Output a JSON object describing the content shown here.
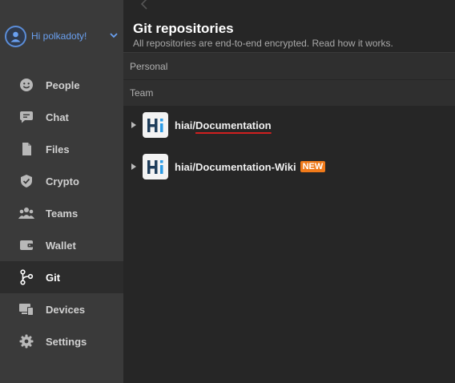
{
  "user": {
    "greeting": "Hi polkadoty!",
    "avatar_icon": "user-icon"
  },
  "sidebar": {
    "items": [
      {
        "label": "People",
        "icon": "smiley-icon"
      },
      {
        "label": "Chat",
        "icon": "chat-bubble-icon"
      },
      {
        "label": "Files",
        "icon": "files-icon"
      },
      {
        "label": "Crypto",
        "icon": "shield-icon"
      },
      {
        "label": "Teams",
        "icon": "teams-icon"
      },
      {
        "label": "Wallet",
        "icon": "wallet-icon"
      },
      {
        "label": "Git",
        "icon": "git-branch-icon",
        "active": true
      },
      {
        "label": "Devices",
        "icon": "devices-icon"
      },
      {
        "label": "Settings",
        "icon": "gear-icon"
      }
    ]
  },
  "main": {
    "title": "Git repositories",
    "subtitle": "All repositories are end-to-end encrypted. Read how it works.",
    "sections": {
      "personal": "Personal",
      "team": "Team"
    },
    "repos": [
      {
        "owner": "hiai/",
        "name": "Documentation",
        "badge": ""
      },
      {
        "owner": "hiai/",
        "name": "Documentation-Wiki",
        "badge": "NEW"
      }
    ]
  },
  "colors": {
    "accent_blue": "#6aa0f0",
    "badge_orange": "#f07a1a",
    "annotation_red": "#d12020"
  }
}
